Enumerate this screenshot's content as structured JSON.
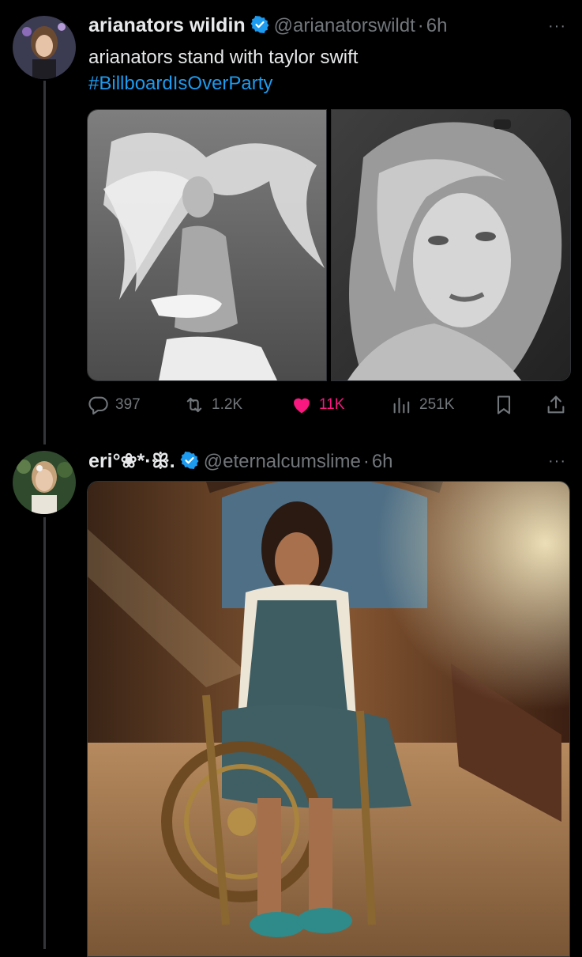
{
  "tweets": [
    {
      "display_name": "arianators wildin",
      "handle": "@arianatorswildt",
      "time": "6h",
      "text_line1": "arianators stand with taylor swift",
      "hashtag": "#BillboardIsOverParty",
      "actions": {
        "replies": "397",
        "retweets": "1.2K",
        "likes": "11K",
        "views": "251K"
      },
      "liked": true
    },
    {
      "display_name": "eri°❀*·ꕥ.",
      "handle": "@eternalcumslime",
      "time": "6h"
    }
  ],
  "separator": "·",
  "more_glyph": "···",
  "colors": {
    "accent": "#1d9bf0",
    "like": "#f91880",
    "verified": "#1d9bf0",
    "muted": "#71767b"
  },
  "icons": [
    "reply-icon",
    "retweet-icon",
    "heart-icon",
    "views-icon",
    "bookmark-icon",
    "share-icon",
    "verified-badge-icon",
    "more-icon"
  ]
}
